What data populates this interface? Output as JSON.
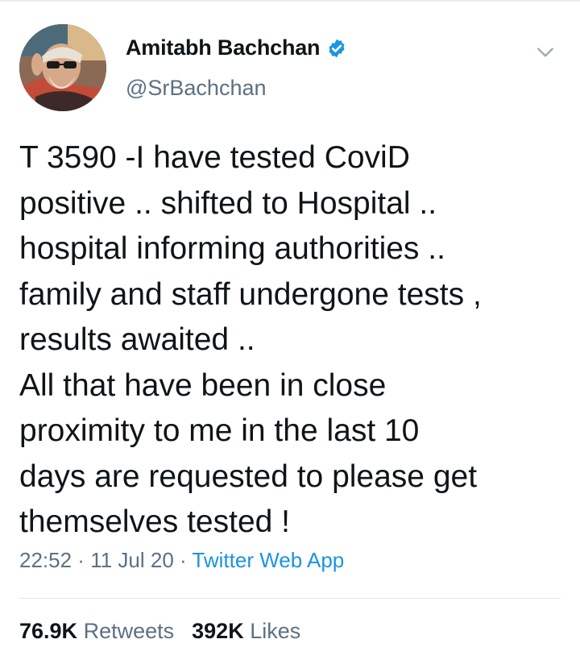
{
  "user": {
    "display_name": "Amitabh Bachchan",
    "handle": "@SrBachchan",
    "verified": true
  },
  "tweet": {
    "text": "T 3590 -I have tested CoviD\npositive ..  shifted to Hospital  ..\nhospital informing  authorities ..\nfamily and staff undergone tests ,\nresults awaited ..\nAll that have been in close\nproximity to me in the last 10\ndays are requested to please get\nthemselves tested !",
    "time": "22:52",
    "separator": " · ",
    "date": "11 Jul 20",
    "source": "Twitter Web App"
  },
  "stats": {
    "retweets_count": "76.9K",
    "retweets_label": "Retweets",
    "likes_count": "392K",
    "likes_label": "Likes"
  },
  "icons": {
    "verified": "verified-badge-icon",
    "menu": "chevron-down-icon"
  },
  "colors": {
    "accent": "#1b95e0",
    "muted": "#5b7083",
    "text": "#0f1419",
    "divider": "#e1e8ed"
  }
}
